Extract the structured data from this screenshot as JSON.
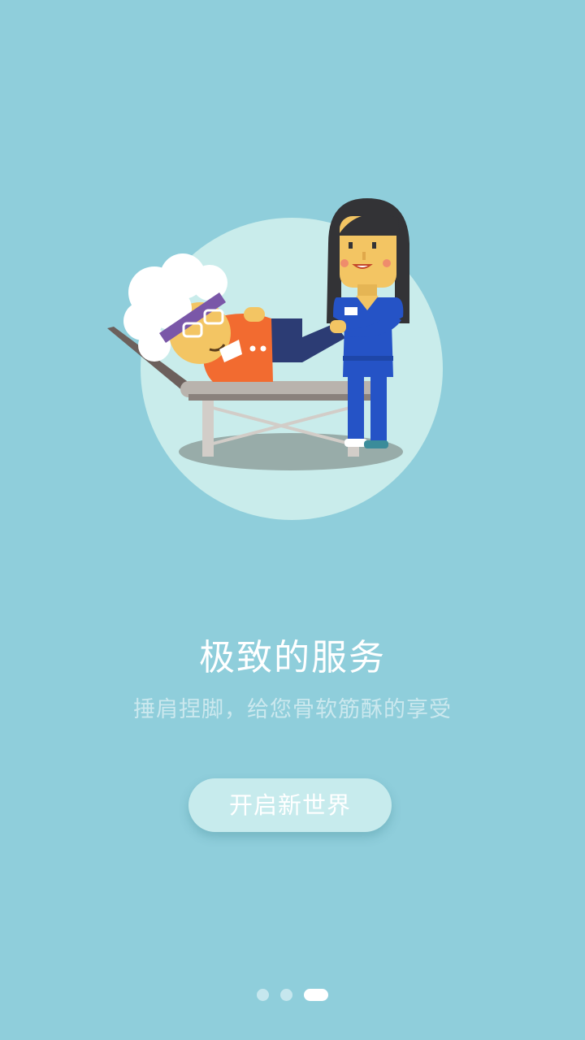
{
  "illustration": {
    "icon": "massage-therapy-illustration",
    "colors": {
      "background": "#8fcedb",
      "circle": "#c9eceb",
      "shadow": "#98aca9",
      "bed": "#b9b3ad",
      "patient_shirt": "#f26b30",
      "nurse_uniform": "#2553c6"
    }
  },
  "onboarding": {
    "title": "极致的服务",
    "subtitle": "捶肩捏脚，给您骨软筋酥的享受",
    "start_button_label": "开启新世界"
  },
  "pager": {
    "total": 3,
    "active_index": 2
  }
}
